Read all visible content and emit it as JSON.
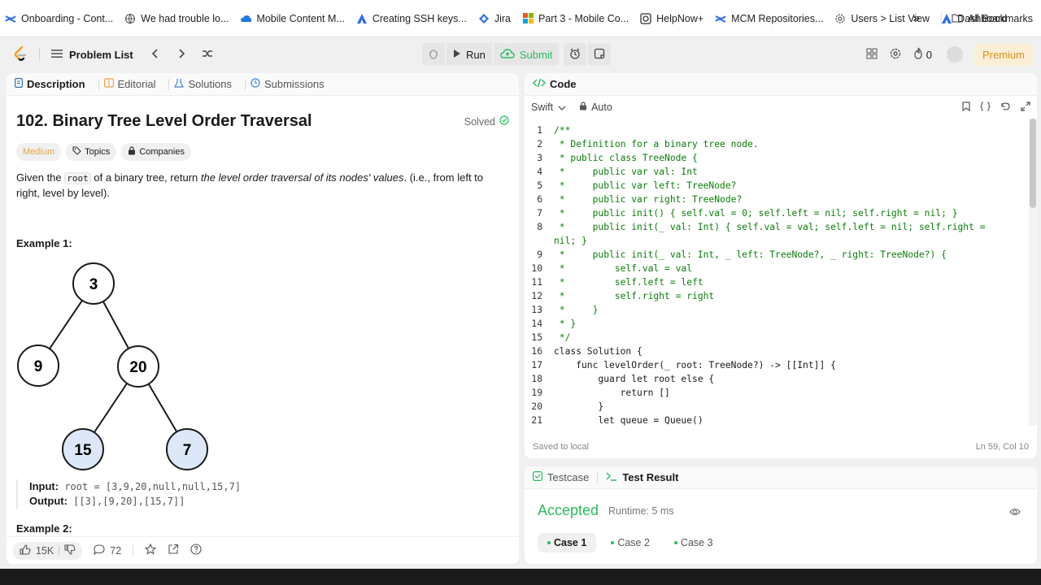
{
  "bookmarks": [
    {
      "label": "Onboarding - Cont...",
      "icon": "confluence-icon"
    },
    {
      "label": "We had trouble lo...",
      "icon": "globe-icon"
    },
    {
      "label": "Mobile Content M...",
      "icon": "cloud-icon"
    },
    {
      "label": "Creating SSH keys...",
      "icon": "atlassian-icon"
    },
    {
      "label": "Jira",
      "icon": "jira-icon"
    },
    {
      "label": "Part 3 - Mobile Co...",
      "icon": "microsoft-icon"
    },
    {
      "label": "HelpNow+",
      "icon": "helpnow-icon"
    },
    {
      "label": "MCM Repositories...",
      "icon": "confluence-icon"
    },
    {
      "label": "Users > List View",
      "icon": "settings-icon"
    },
    {
      "label": "Dashboard",
      "icon": "atlassian-icon"
    }
  ],
  "bookmarks_more": "»",
  "all_bookmarks": "All Bookmarks",
  "nav": {
    "problem_list": "Problem List",
    "run": "Run",
    "submit": "Submit",
    "streak": "0",
    "premium": "Premium"
  },
  "left": {
    "tabs": [
      "Description",
      "Editorial",
      "Solutions",
      "Submissions"
    ],
    "title": "102. Binary Tree Level Order Traversal",
    "solved": "Solved",
    "tags": {
      "difficulty": "Medium",
      "topics": "Topics",
      "companies": "Companies"
    },
    "statement_pre": "Given the ",
    "statement_code": "root",
    "statement_mid": " of a binary tree, return ",
    "statement_em": "the level order traversal of its nodes' values",
    "statement_post": ". (i.e., from left to right, level by level).",
    "example1": "Example 1:",
    "tree_nodes": [
      "3",
      "9",
      "20",
      "15",
      "7"
    ],
    "input_label": "Input:",
    "input_value": "root = [3,9,20,null,null,15,7]",
    "output_label": "Output:",
    "output_value": "[[3],[9,20],[15,7]]",
    "example2": "Example 2:",
    "likes": "15K",
    "comments": "72"
  },
  "code": {
    "header": "Code",
    "language": "Swift",
    "mode": "Auto",
    "status_left": "Saved to local",
    "status_right": "Ln 59, Col 10",
    "lines": [
      {
        "n": "1",
        "t": "/**"
      },
      {
        "n": "2",
        "t": " * Definition for a binary tree node."
      },
      {
        "n": "3",
        "t": " * public class TreeNode {"
      },
      {
        "n": "4",
        "t": " *     public var val: Int"
      },
      {
        "n": "5",
        "t": " *     public var left: TreeNode?"
      },
      {
        "n": "6",
        "t": " *     public var right: TreeNode?"
      },
      {
        "n": "7",
        "t": " *     public init() { self.val = 0; self.left = nil; self.right = nil; }"
      },
      {
        "n": "8",
        "t": " *     public init(_ val: Int) { self.val = val; self.left = nil; self.right ="
      },
      {
        "n": "",
        "t": "nil; }"
      },
      {
        "n": "9",
        "t": " *     public init(_ val: Int, _ left: TreeNode?, _ right: TreeNode?) {"
      },
      {
        "n": "10",
        "t": " *         self.val = val"
      },
      {
        "n": "11",
        "t": " *         self.left = left"
      },
      {
        "n": "12",
        "t": " *         self.right = right"
      },
      {
        "n": "13",
        "t": " *     }"
      },
      {
        "n": "14",
        "t": " * }"
      },
      {
        "n": "15",
        "t": " */"
      },
      {
        "n": "16",
        "t": "class Solution {"
      },
      {
        "n": "17",
        "t": "    func levelOrder(_ root: TreeNode?) -> [[Int]] {"
      },
      {
        "n": "18",
        "t": "        guard let root else {"
      },
      {
        "n": "19",
        "t": "            return []"
      },
      {
        "n": "20",
        "t": "        }"
      },
      {
        "n": "21",
        "t": "        let queue = Queue()"
      }
    ]
  },
  "test": {
    "tab_testcase": "Testcase",
    "tab_result": "Test Result",
    "accepted": "Accepted",
    "runtime": "Runtime: 5 ms",
    "cases": [
      "Case 1",
      "Case 2",
      "Case 3"
    ]
  },
  "colors": {
    "accent_green": "#2cbb5d",
    "medium": "#e6a23c",
    "premium": "#d58f1a",
    "tree_leaf_fill": "#dce8f7"
  }
}
